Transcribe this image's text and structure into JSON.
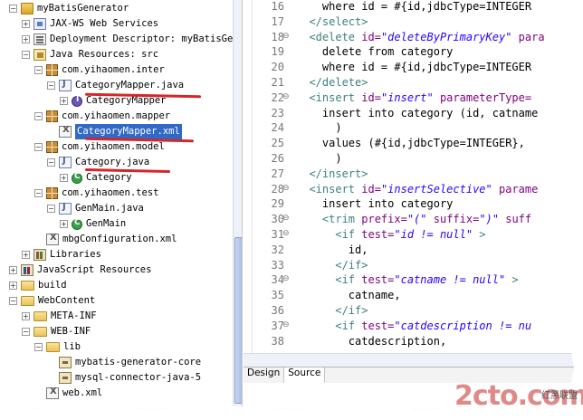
{
  "tree": {
    "rows": [
      {
        "twisty": "−",
        "icon": "project-icon",
        "label": "myBatisGenerator"
      },
      {
        "twisty": "+",
        "icon": "web-services-icon",
        "label": "JAX-WS Web Services"
      },
      {
        "twisty": "+",
        "icon": "deployment-descriptor-icon",
        "label": "Deployment Descriptor: myBatisGe"
      },
      {
        "twisty": "−",
        "icon": "source-folder-icon",
        "label": "Java Resources: src"
      },
      {
        "twisty": "−",
        "icon": "package-icon",
        "label": "com.yihaomen.inter"
      },
      {
        "twisty": "−",
        "icon": "java-file-icon",
        "label": "CategoryMapper.java"
      },
      {
        "twisty": "+",
        "icon": "interface-icon",
        "label": "CategoryMapper"
      },
      {
        "twisty": "−",
        "icon": "package-icon",
        "label": "com.yihaomen.mapper"
      },
      {
        "twisty": "",
        "icon": "xml-file-icon",
        "label": "CategoryMapper.xml"
      },
      {
        "twisty": "−",
        "icon": "package-icon",
        "label": "com.yihaomen.model"
      },
      {
        "twisty": "−",
        "icon": "java-file-icon",
        "label": "Category.java"
      },
      {
        "twisty": "+",
        "icon": "class-icon",
        "label": "Category"
      },
      {
        "twisty": "−",
        "icon": "package-icon",
        "label": "com.yihaomen.test"
      },
      {
        "twisty": "−",
        "icon": "java-file-icon",
        "label": "GenMain.java"
      },
      {
        "twisty": "+",
        "icon": "class-icon",
        "label": "GenMain"
      },
      {
        "twisty": "",
        "icon": "xml-file-icon",
        "label": "mbgConfiguration.xml"
      },
      {
        "twisty": "+",
        "icon": "library-icon",
        "label": "Libraries"
      },
      {
        "twisty": "+",
        "icon": "js-resources-icon",
        "label": "JavaScript Resources"
      },
      {
        "twisty": "+",
        "icon": "folder-icon",
        "label": "build"
      },
      {
        "twisty": "−",
        "icon": "folder-icon",
        "label": "WebContent"
      },
      {
        "twisty": "+",
        "icon": "folder-icon",
        "label": "META-INF"
      },
      {
        "twisty": "−",
        "icon": "folder-icon",
        "label": "WEB-INF"
      },
      {
        "twisty": "−",
        "icon": "folder-icon",
        "label": "lib"
      },
      {
        "twisty": "",
        "icon": "jar-icon",
        "label": "mybatis-generator-core"
      },
      {
        "twisty": "",
        "icon": "jar-icon",
        "label": "mysql-connector-java-5"
      },
      {
        "twisty": "",
        "icon": "xml-file-icon",
        "label": "web.xml"
      }
    ]
  },
  "editor": {
    "lines": [
      {
        "num": "16",
        "fold": "",
        "segments": [
          {
            "c": "txt",
            "t": "    where id = #{id,jdbcType=INTEGER"
          }
        ]
      },
      {
        "num": "17",
        "fold": "",
        "segments": [
          {
            "c": "tag",
            "t": "  </select>"
          }
        ]
      },
      {
        "num": "18",
        "fold": "⊖",
        "segments": [
          {
            "c": "tag",
            "t": "  <delete "
          },
          {
            "c": "attr",
            "t": "id="
          },
          {
            "c": "val",
            "t": "\"deleteByPrimaryKey\""
          },
          {
            "c": "attr",
            "t": " para"
          }
        ]
      },
      {
        "num": "19",
        "fold": "",
        "segments": [
          {
            "c": "txt",
            "t": "    delete from category"
          }
        ]
      },
      {
        "num": "20",
        "fold": "",
        "segments": [
          {
            "c": "txt",
            "t": "    where id = #{id,jdbcType=INTEGER"
          }
        ]
      },
      {
        "num": "21",
        "fold": "",
        "segments": [
          {
            "c": "tag",
            "t": "  </delete>"
          }
        ]
      },
      {
        "num": "22",
        "fold": "⊖",
        "segments": [
          {
            "c": "tag",
            "t": "  <insert "
          },
          {
            "c": "attr",
            "t": "id="
          },
          {
            "c": "val",
            "t": "\"insert\""
          },
          {
            "c": "attr",
            "t": " parameterType="
          }
        ]
      },
      {
        "num": "23",
        "fold": "",
        "segments": [
          {
            "c": "txt",
            "t": "    insert into category (id, catname"
          }
        ]
      },
      {
        "num": "24",
        "fold": "",
        "segments": [
          {
            "c": "txt",
            "t": "      )"
          }
        ]
      },
      {
        "num": "25",
        "fold": "",
        "segments": [
          {
            "c": "txt",
            "t": "    values (#{id,jdbcType=INTEGER},"
          }
        ]
      },
      {
        "num": "26",
        "fold": "",
        "segments": [
          {
            "c": "txt",
            "t": "      )"
          }
        ]
      },
      {
        "num": "27",
        "fold": "",
        "segments": [
          {
            "c": "tag",
            "t": "  </insert>"
          }
        ]
      },
      {
        "num": "28",
        "fold": "⊖",
        "segments": [
          {
            "c": "tag",
            "t": "  <insert "
          },
          {
            "c": "attr",
            "t": "id="
          },
          {
            "c": "val",
            "t": "\"insertSelective\""
          },
          {
            "c": "attr",
            "t": " parame"
          }
        ]
      },
      {
        "num": "29",
        "fold": "",
        "segments": [
          {
            "c": "txt",
            "t": "    insert into category"
          }
        ]
      },
      {
        "num": "30",
        "fold": "⊖",
        "segments": [
          {
            "c": "tag",
            "t": "    <trim "
          },
          {
            "c": "attr",
            "t": "prefix="
          },
          {
            "c": "val",
            "t": "\"(\""
          },
          {
            "c": "attr",
            "t": " suffix="
          },
          {
            "c": "val",
            "t": "\")\""
          },
          {
            "c": "attr",
            "t": " suff"
          }
        ]
      },
      {
        "num": "31",
        "fold": "⊖",
        "segments": [
          {
            "c": "tag",
            "t": "      <if "
          },
          {
            "c": "attr",
            "t": "test="
          },
          {
            "c": "val",
            "t": "\"id != null\""
          },
          {
            "c": "tag",
            "t": " >"
          }
        ]
      },
      {
        "num": "32",
        "fold": "",
        "segments": [
          {
            "c": "txt",
            "t": "        id,"
          }
        ]
      },
      {
        "num": "33",
        "fold": "",
        "segments": [
          {
            "c": "tag",
            "t": "      </if>"
          }
        ]
      },
      {
        "num": "34",
        "fold": "⊖",
        "segments": [
          {
            "c": "tag",
            "t": "      <if "
          },
          {
            "c": "attr",
            "t": "test="
          },
          {
            "c": "val",
            "t": "\"catname != null\""
          },
          {
            "c": "tag",
            "t": " >"
          }
        ]
      },
      {
        "num": "35",
        "fold": "",
        "segments": [
          {
            "c": "txt",
            "t": "        catname,"
          }
        ]
      },
      {
        "num": "36",
        "fold": "",
        "segments": [
          {
            "c": "tag",
            "t": "      </if>"
          }
        ]
      },
      {
        "num": "37",
        "fold": "⊖",
        "segments": [
          {
            "c": "tag",
            "t": "      <if "
          },
          {
            "c": "attr",
            "t": "test="
          },
          {
            "c": "val",
            "t": "\"catdescription != nu"
          }
        ]
      },
      {
        "num": "38",
        "fold": "",
        "segments": [
          {
            "c": "txt",
            "t": "        catdescription,"
          }
        ]
      }
    ],
    "tabs": [
      "Design",
      "Source"
    ],
    "active_tab": "Source"
  },
  "watermark": {
    "main": "2cto.com",
    "sub": "红黑联盟"
  },
  "colors": {
    "tag": "#3f7f7f",
    "attr": "#7f007f",
    "value": "#2a00ff",
    "selection": "#3169c6",
    "annotation": "#d6262a"
  }
}
